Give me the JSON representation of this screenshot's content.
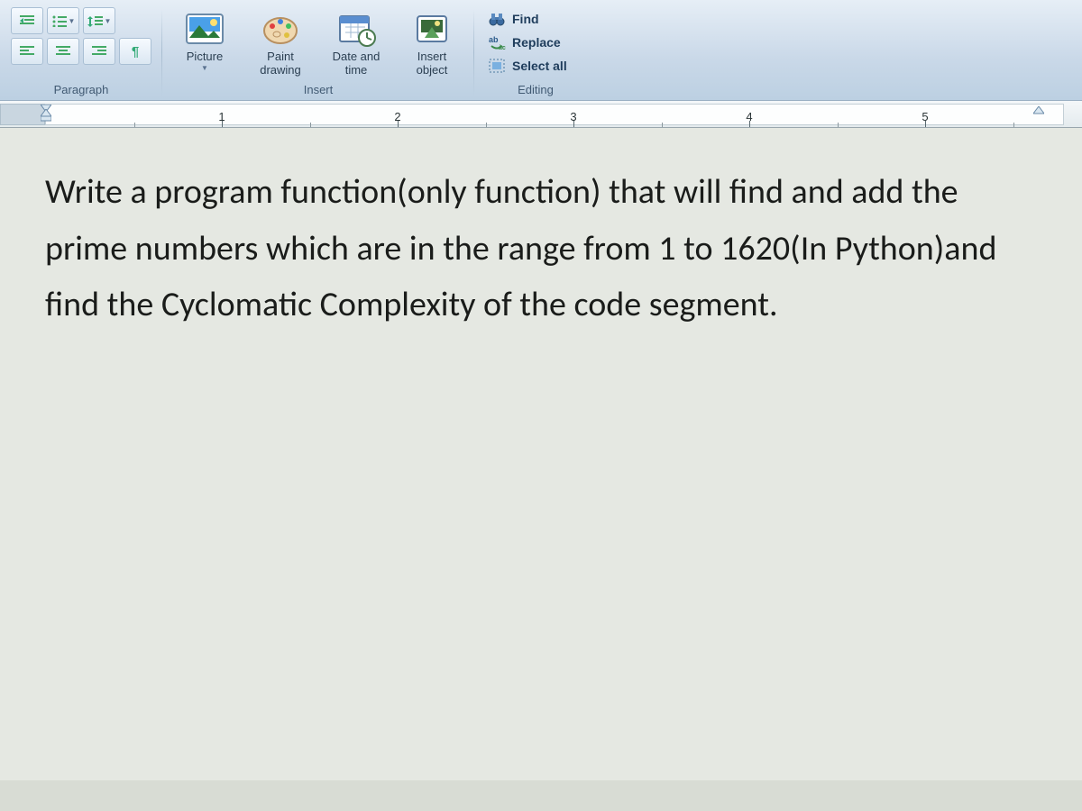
{
  "ribbon": {
    "paragraph": {
      "label": "Paragraph",
      "buttons": {
        "decrease_indent": "",
        "bullets": "",
        "line_spacing": "",
        "align_left": "",
        "align_center": "",
        "align_right": "",
        "show_marks": ""
      }
    },
    "insert": {
      "label": "Insert",
      "picture": "Picture",
      "paint_drawing": "Paint\ndrawing",
      "date_time": "Date and\ntime",
      "insert_object": "Insert\nobject"
    },
    "editing": {
      "label": "Editing",
      "find": "Find",
      "replace": "Replace",
      "select_all": "Select all"
    }
  },
  "ruler": {
    "numbers": [
      "1",
      "2",
      "3",
      "4",
      "5"
    ]
  },
  "document": {
    "body": "Write a program function(only function) that will find and add the prime numbers which are in the range from 1 to 1620(In  Python)and find the Cyclomatic Complexity of the code segment."
  }
}
